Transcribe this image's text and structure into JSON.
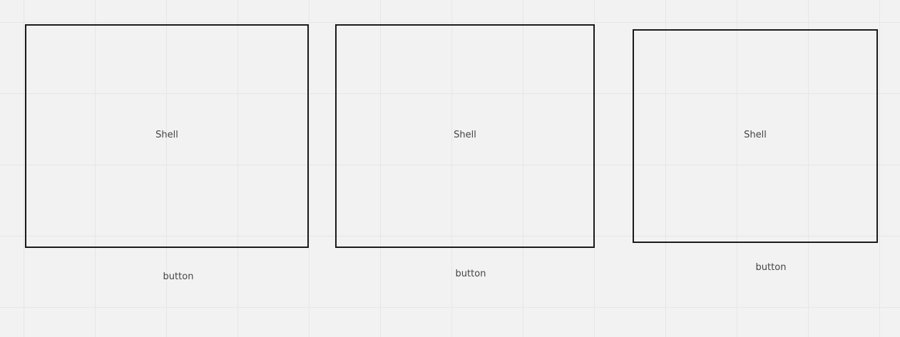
{
  "diagram": {
    "nodes": [
      {
        "shell_label": "Shell",
        "caption": "button"
      },
      {
        "shell_label": "Shell",
        "caption": "button"
      },
      {
        "shell_label": "Shell",
        "caption": "button"
      }
    ]
  },
  "colors": {
    "background": "#f2f2f2",
    "grid_line": "#e6e6e6",
    "box_border": "#1a1a1a",
    "text": "#444444"
  }
}
